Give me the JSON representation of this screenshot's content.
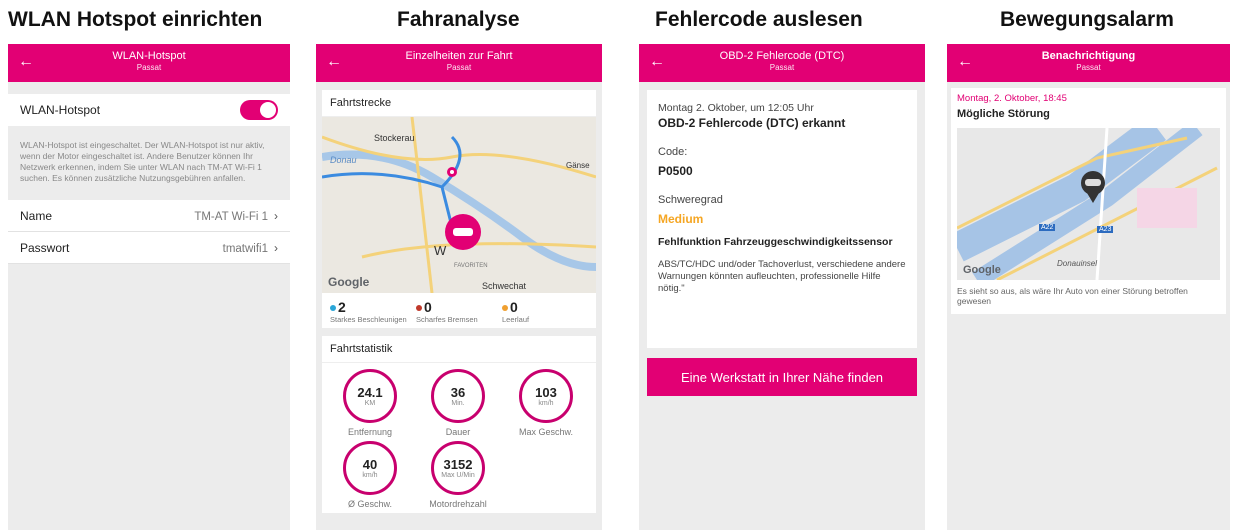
{
  "panels": {
    "p1": {
      "caption": "WLAN Hotspot einrichten",
      "appbar_title": "WLAN-Hotspot",
      "appbar_subtitle": "Passat",
      "toggle_label": "WLAN-Hotspot",
      "toggle_on": true,
      "note": "WLAN-Hotspot ist eingeschaltet. Der WLAN-Hotspot ist nur aktiv, wenn der Motor eingeschaltet ist. Andere Benutzer können Ihr Netzwerk erkennen, indem Sie unter WLAN nach TM-AT Wi-Fi 1 suchen. Es können zusätzliche Nutzungsgebühren anfallen.",
      "items": [
        {
          "label": "Name",
          "value": "TM-AT Wi-Fi 1"
        },
        {
          "label": "Passwort",
          "value": "tmatwifi1"
        }
      ]
    },
    "p2": {
      "caption": "Fahranalyse",
      "appbar_title": "Einzelheiten zur Fahrt",
      "appbar_subtitle": "Passat",
      "route_header": "Fahrtstrecke",
      "map_labels": {
        "stockerau": "Stockerau",
        "donau": "Donau",
        "gaense": "Gänse",
        "favoriten": "FAVORITEN",
        "schwechat": "Schwechat",
        "w": "W"
      },
      "google": "Google",
      "events": [
        {
          "count": "2",
          "label": "Starkes Beschleunigen",
          "color": "#2aa6d8"
        },
        {
          "count": "0",
          "label": "Scharfes Bremsen",
          "color": "#c0392b"
        },
        {
          "count": "0",
          "label": "Leerlauf",
          "color": "#f0a030"
        }
      ],
      "stats_header": "Fahrtstatistik",
      "stats": [
        {
          "value": "24.1",
          "unit": "KM",
          "label": "Entfernung"
        },
        {
          "value": "36",
          "unit": "Min.",
          "label": "Dauer"
        },
        {
          "value": "103",
          "unit": "km/h",
          "label": "Max Geschw."
        },
        {
          "value": "40",
          "unit": "km/h",
          "label": "Ø Geschw."
        },
        {
          "value": "3152",
          "unit": "Max U/Min",
          "label": "Motordrehzahl"
        }
      ]
    },
    "p3": {
      "caption": "Fehlercode auslesen",
      "appbar_title": "OBD-2 Fehlercode (DTC)",
      "appbar_subtitle": "Passat",
      "date": "Montag 2. Oktober, um 12:05 Uhr",
      "heading": "OBD-2 Fehlercode (DTC) erkannt",
      "code_label": "Code:",
      "code_value": "P0500",
      "severity_label": "Schweregrad",
      "severity_value": "Medium",
      "function": "Fehlfunktion Fahrzeuggeschwindigkeitssensor",
      "description": "ABS/TC/HDC und/oder Tachoverlust, verschiedene andere Warnungen könnten aufleuchten, professionelle Hilfe nötig.\"",
      "button": "Eine Werkstatt in Ihrer Nähe finden"
    },
    "p4": {
      "caption": "Bewegungsalarm",
      "appbar_title": "Benachrichtigung",
      "appbar_subtitle": "Passat",
      "date": "Montag, 2. Oktober, 18:45",
      "heading": "Mögliche Störung",
      "google": "Google",
      "map_label": "Donauinsel",
      "road_labels": [
        "A22",
        "A23"
      ],
      "description": "Es sieht so aus, als wäre Ihr Auto von einer Störung betroffen gewesen"
    }
  },
  "colors": {
    "accent": "#e20074",
    "medium": "#f5a623"
  }
}
